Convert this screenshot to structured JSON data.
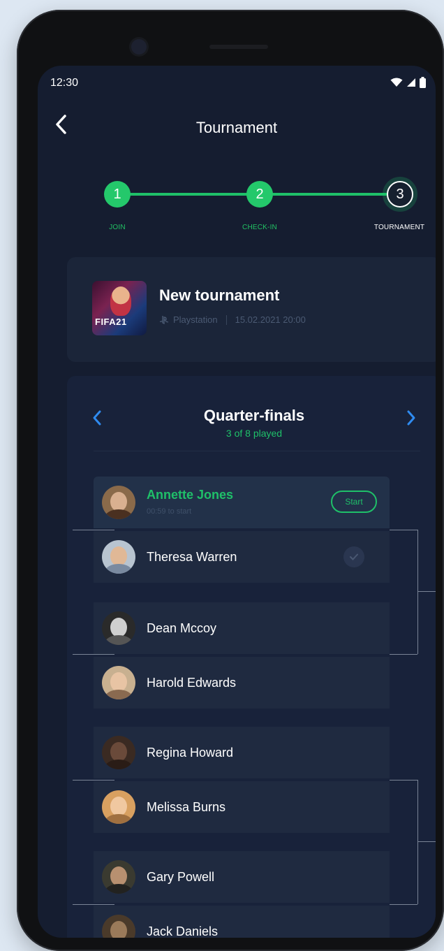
{
  "status_bar": {
    "time": "12:30"
  },
  "header": {
    "title": "Tournament",
    "back_icon": "chevron-left-icon"
  },
  "stepper": {
    "steps": [
      {
        "number": "1",
        "label": "JOIN",
        "state": "done"
      },
      {
        "number": "2",
        "label": "CHECK-IN",
        "state": "done"
      },
      {
        "number": "3",
        "label": "TOURNAMENT",
        "state": "current"
      }
    ],
    "accent_color": "#1fc069"
  },
  "tournament": {
    "name": "New tournament",
    "platform": "Playstation",
    "date": "15.02.2021 20:00",
    "game_thumb_text": "FIFA21"
  },
  "round": {
    "title": "Quarter-finals",
    "progress": "3 of 8 played"
  },
  "matches": [
    {
      "players": [
        {
          "name": "Annette Jones",
          "sub": "00:59 to start",
          "leader": true,
          "action": "Start"
        },
        {
          "name": "Theresa Warren",
          "checked": true
        }
      ]
    },
    {
      "players": [
        {
          "name": "Dean Mccoy"
        },
        {
          "name": "Harold Edwards"
        }
      ]
    },
    {
      "players": [
        {
          "name": "Regina Howard"
        },
        {
          "name": "Melissa Burns"
        }
      ]
    },
    {
      "players": [
        {
          "name": "Gary Powell"
        },
        {
          "name": "Jack Daniels"
        }
      ]
    }
  ],
  "colors": {
    "background": "#151d30",
    "card": "#1b2539",
    "row": "#1f2a40",
    "accent": "#1fc069"
  }
}
